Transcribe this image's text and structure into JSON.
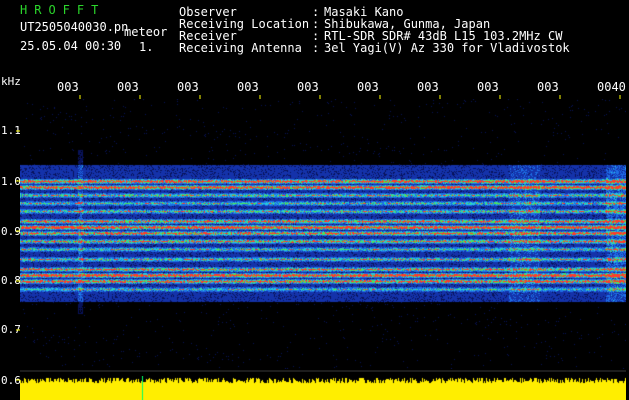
{
  "brand": "HROFFT",
  "filename": "UT2505040030.pn",
  "meteor_label": "meteor",
  "datetime": "25.05.04 00:30",
  "unit_mark": "1.",
  "header": {
    "rows": [
      {
        "label": "Observer",
        "value": "Masaki Kano"
      },
      {
        "label": "Receiving Location",
        "value": "Shibukawa, Gunma, Japan"
      },
      {
        "label": "Receiver",
        "value": "RTL-SDR SDR# 43dB L15 103.2MHz CW"
      },
      {
        "label": "Receiving Antenna",
        "value": "3el Yagi(V) Az 330 for Vladivostok"
      }
    ]
  },
  "yaxis": {
    "unit": "kHz",
    "ticks": [
      "1.1",
      "1.0",
      "0.9",
      "0.8",
      "0.7",
      "0.6"
    ]
  },
  "xaxis": {
    "ticks": [
      "003",
      "003",
      "003",
      "003",
      "003",
      "003",
      "003",
      "003",
      "003",
      "0040"
    ]
  },
  "colors": {
    "brand": "#2bd62b",
    "background": "#000000",
    "spectrum_base": "#0a1a6a",
    "amplitude": "#ffee00",
    "tick_yellow": "#ffff00"
  }
}
